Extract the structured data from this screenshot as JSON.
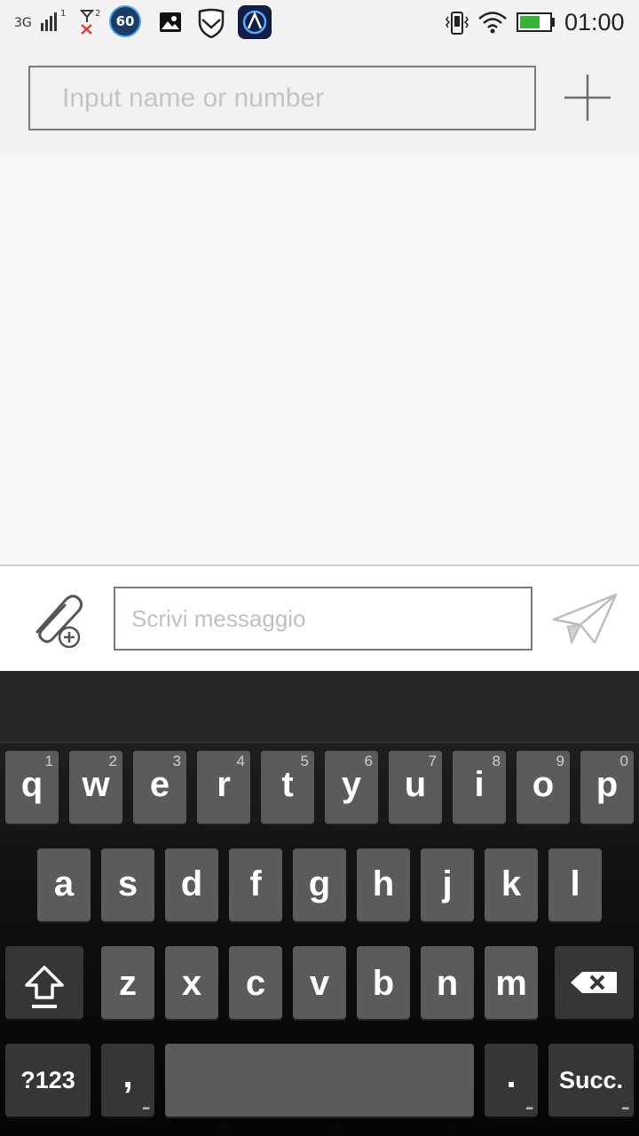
{
  "status_bar": {
    "network": "3G",
    "sim1": "1",
    "sim2": "2",
    "badge": "60",
    "time": "01:00",
    "icons": [
      "signal-icon",
      "no-signal-icon",
      "speed-badge-icon",
      "gallery-icon",
      "shield-icon",
      "app-icon",
      "vibrate-icon",
      "wifi-icon",
      "battery-icon"
    ],
    "battery_color": "#39b339"
  },
  "recipient": {
    "placeholder": "Input name or number",
    "add_icon": "plus-icon"
  },
  "compose": {
    "placeholder": "Scrivi messaggio",
    "attach_icon": "paperclip-add-icon",
    "send_icon": "send-plane-icon"
  },
  "keyboard": {
    "row1": [
      {
        "label": "q",
        "hint": "1"
      },
      {
        "label": "w",
        "hint": "2"
      },
      {
        "label": "e",
        "hint": "3"
      },
      {
        "label": "r",
        "hint": "4"
      },
      {
        "label": "t",
        "hint": "5"
      },
      {
        "label": "y",
        "hint": "6"
      },
      {
        "label": "u",
        "hint": "7"
      },
      {
        "label": "i",
        "hint": "8"
      },
      {
        "label": "o",
        "hint": "9"
      },
      {
        "label": "p",
        "hint": "0"
      }
    ],
    "row2": [
      "a",
      "s",
      "d",
      "f",
      "g",
      "h",
      "j",
      "k",
      "l"
    ],
    "row3": [
      "z",
      "x",
      "c",
      "v",
      "b",
      "n",
      "m"
    ],
    "symbols_label": "?123",
    "comma_label": ",",
    "period_label": ".",
    "enter_label": "Succ.",
    "shift_icon": "shift-arrow-icon",
    "backspace_icon": "backspace-icon"
  }
}
